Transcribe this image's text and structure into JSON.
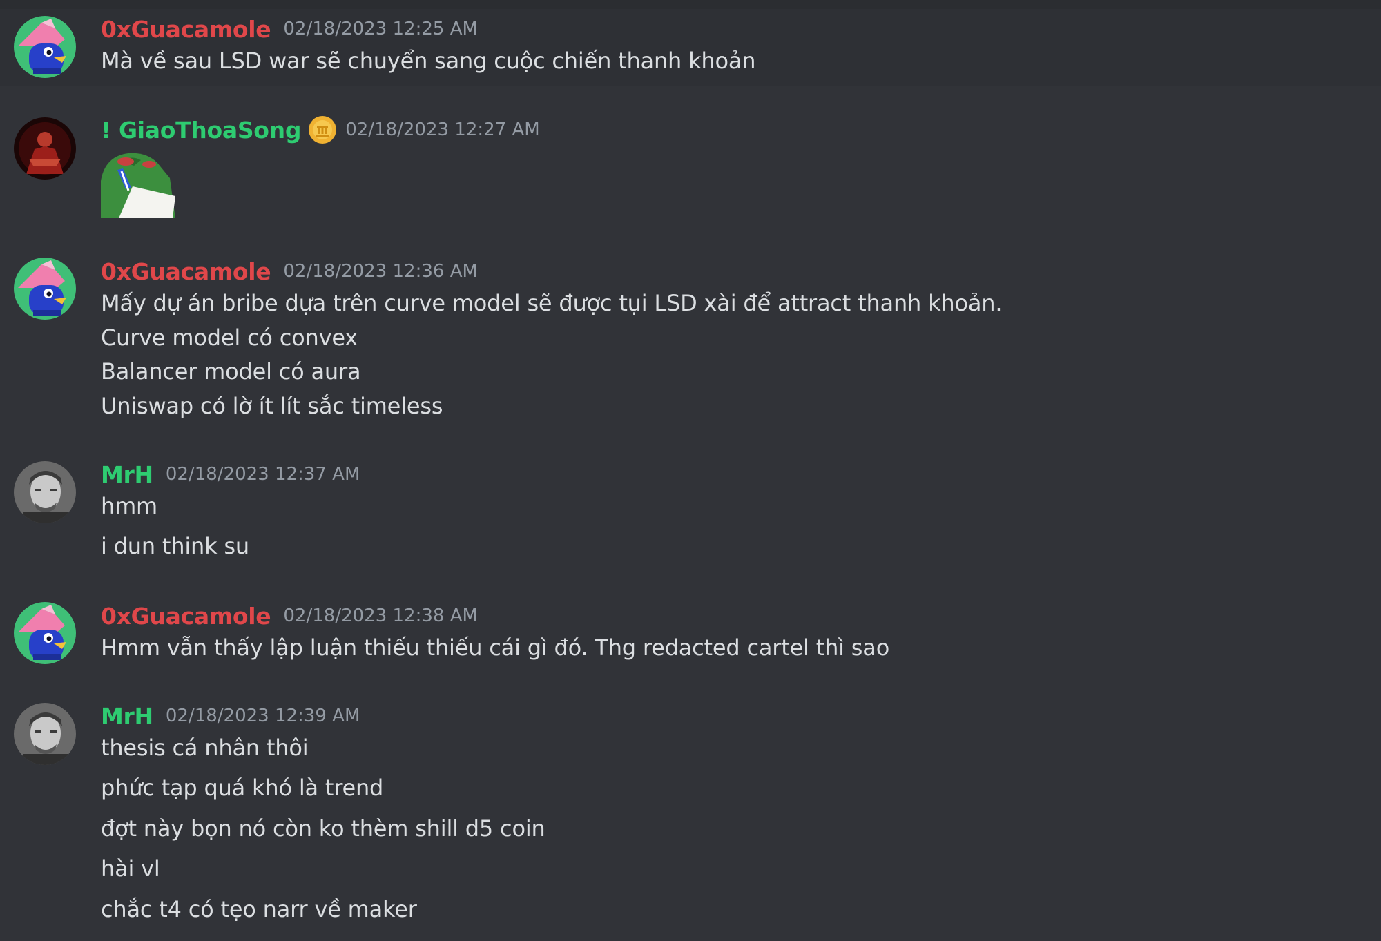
{
  "colors": {
    "background": "#313338",
    "hover_background": "#2e3035",
    "text": "#dbdee1",
    "timestamp": "#949ba4",
    "role_red": "#e0474a",
    "role_green": "#2ecc71"
  },
  "messages": [
    {
      "username": "0xGuacamole",
      "timestamp": "02/18/2023 12:25 AM",
      "avatar_icon": "pink-duck-avatar-icon",
      "lines": [
        "Mà về sau LSD war sẽ chuyển sang cuộc chiến thanh khoản"
      ]
    },
    {
      "username": "! GiaoThoaSong",
      "timestamp": "02/18/2023 12:27 AM",
      "avatar_icon": "red-figure-avatar-icon",
      "badge_icon": "gold-coin-badge-icon",
      "sticker_icon": "pepe-notes-sticker-icon"
    },
    {
      "username": "0xGuacamole",
      "timestamp": "02/18/2023 12:36 AM",
      "avatar_icon": "pink-duck-avatar-icon",
      "lines": [
        "Mấy dự án bribe dựa trên curve model sẽ được tụi LSD xài để attract thanh khoản.",
        "Curve model có convex",
        "Balancer model có aura",
        "Uniswap có lờ ít lít sắc timeless"
      ]
    },
    {
      "username": "MrH",
      "timestamp": "02/18/2023 12:37 AM",
      "avatar_icon": "man-portrait-avatar-icon",
      "lines": [
        "hmm",
        "i dun think su"
      ]
    },
    {
      "username": "0xGuacamole",
      "timestamp": "02/18/2023 12:38 AM",
      "avatar_icon": "pink-duck-avatar-icon",
      "lines": [
        "Hmm vẫn thấy lập luận thiếu thiếu cái gì đó. Thg redacted cartel thì sao"
      ]
    },
    {
      "username": "MrH",
      "timestamp": "02/18/2023 12:39 AM",
      "avatar_icon": "man-portrait-avatar-icon",
      "lines": [
        "thesis cá nhân thôi",
        "phức tạp quá khó là trend",
        "đợt này bọn nó còn ko thèm shill d5 coin",
        "hài vl",
        "chắc t4 có tẹo narr về maker"
      ]
    }
  ]
}
